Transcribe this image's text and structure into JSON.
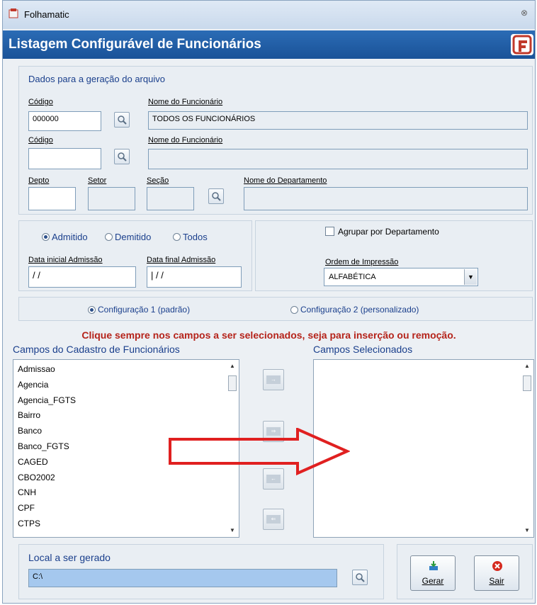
{
  "window": {
    "app_title": "Folhamatic",
    "close": "⊗"
  },
  "banner": {
    "title": "Listagem Configurável de Funcionários"
  },
  "dados": {
    "section_title": "Dados para a geração do arquivo",
    "codigo1_label": "Código",
    "codigo1_value": "000000",
    "nome1_label": "Nome do Funcionário",
    "nome1_value": "TODOS OS FUNCIONÁRIOS",
    "codigo2_label": "Código",
    "codigo2_value": "",
    "nome2_label": "Nome do Funcionário",
    "nome2_value": "",
    "depto_label": "Depto",
    "setor_label": "Setor",
    "secao_label": "Seção",
    "nome_depto_label": "Nome do Departamento"
  },
  "filtro": {
    "radios": [
      {
        "label": "Admitido",
        "selected": true
      },
      {
        "label": "Demitido",
        "selected": false
      },
      {
        "label": "Todos",
        "selected": false
      }
    ],
    "data_inicial_label": "Data inicial Admissão",
    "data_inicial_value": " / /",
    "data_final_label": "Data final Admissão",
    "data_final_value": "| / /"
  },
  "opcoes": {
    "agrupar_label": "Agrupar por Departamento",
    "agrupar_checked": false,
    "ordem_label": "Ordem de Impressão",
    "ordem_value": "ALFABÉTICA"
  },
  "config": {
    "opt1": "Configuração 1 (padrão)",
    "opt1_selected": true,
    "opt2": "Configuração 2 (personalizado)",
    "opt2_selected": false
  },
  "hint": "Clique sempre nos campos a ser selecionados, seja para inserção ou remoção.",
  "lists": {
    "left_title": "Campos do Cadastro de Funcionários",
    "right_title": "Campos Selecionados",
    "left_items": [
      "Admissao",
      "Agencia",
      "Agencia_FGTS",
      "Bairro",
      "Banco",
      "Banco_FGTS",
      "CAGED",
      "CBO2002",
      "CNH",
      "CPF",
      "CTPS"
    ],
    "right_items": []
  },
  "local": {
    "label": "Local a ser gerado",
    "value": "C:\\"
  },
  "buttons": {
    "gerar": "Gerar",
    "sair": "Sair"
  },
  "colors": {
    "banner": "#1a5298",
    "hint": "#b5231a",
    "label_blue": "#1a3f8c"
  }
}
